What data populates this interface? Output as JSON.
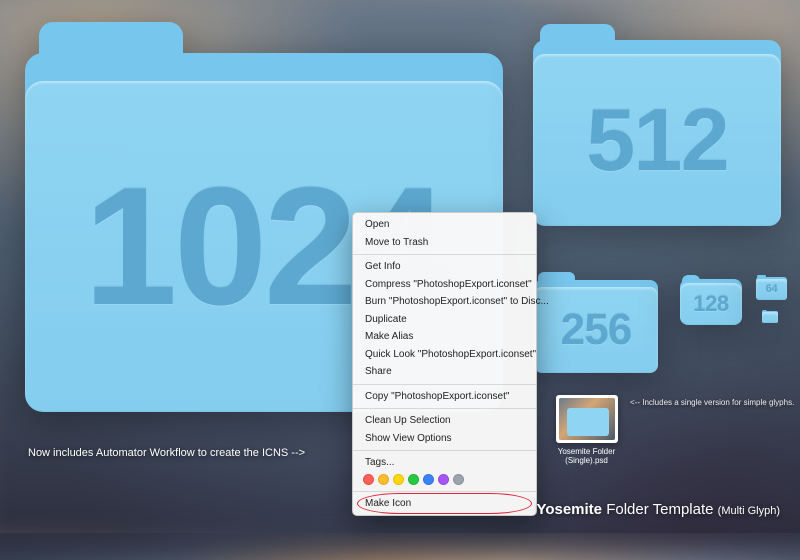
{
  "folders": {
    "f1024": "1024",
    "f512": "512",
    "f256": "256",
    "f128": "128",
    "f64": "64",
    "f32": ""
  },
  "menu": {
    "open": "Open",
    "trash": "Move to Trash",
    "getinfo": "Get Info",
    "compress": "Compress \"PhotoshopExport.iconset\"",
    "burn": "Burn \"PhotoshopExport.iconset\" to Disc...",
    "duplicate": "Duplicate",
    "alias": "Make Alias",
    "quicklook": "Quick Look \"PhotoshopExport.iconset\"",
    "share": "Share",
    "copy": "Copy \"PhotoshopExport.iconset\"",
    "cleanup": "Clean Up Selection",
    "viewopts": "Show View Options",
    "tags": "Tags...",
    "makeicon": "Make Icon"
  },
  "tag_colors": [
    "#ff5f57",
    "#ffbd2e",
    "#ffd60a",
    "#28c840",
    "#3b82f6",
    "#a855f7",
    "#9ca3af"
  ],
  "captions": {
    "left": "Now includes Automator Workflow to create the ICNS -->",
    "thumb_line1": "Yosemite Folder",
    "thumb_line2": "(Single).psd",
    "thumb_note": "<-- Includes a single version for simple glyphs."
  },
  "title": {
    "bold": "Yosemite",
    "thin": " Folder Template ",
    "sub": "(Multi Glyph)"
  }
}
